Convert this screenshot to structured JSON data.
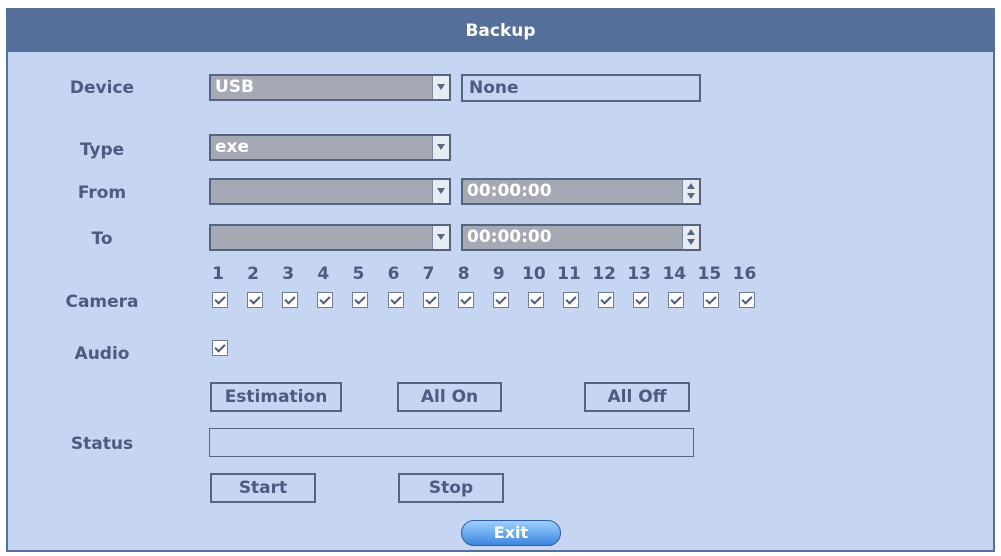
{
  "window": {
    "title": "Backup"
  },
  "device": {
    "label": "Device",
    "value": "USB",
    "name": "None"
  },
  "type": {
    "label": "Type",
    "value": "exe"
  },
  "from": {
    "label": "From",
    "date": "",
    "time": "00:00:00"
  },
  "to": {
    "label": "To",
    "date": "",
    "time": "00:00:00"
  },
  "camera": {
    "label": "Camera",
    "numbers": [
      "1",
      "2",
      "3",
      "4",
      "5",
      "6",
      "7",
      "8",
      "9",
      "10",
      "11",
      "12",
      "13",
      "14",
      "15",
      "16"
    ],
    "checked": [
      true,
      true,
      true,
      true,
      true,
      true,
      true,
      true,
      true,
      true,
      true,
      true,
      true,
      true,
      true,
      true
    ]
  },
  "audio": {
    "label": "Audio",
    "checked": true
  },
  "buttons": {
    "estimation": "Estimation",
    "all_on": "All On",
    "all_off": "All Off",
    "start": "Start",
    "stop": "Stop",
    "exit": "Exit"
  },
  "status": {
    "label": "Status",
    "value": ""
  },
  "colors": {
    "panel": "#c6d5f2",
    "titlebar": "#566e9a",
    "text": "#4d5b80",
    "combo": "#a5a9b4",
    "exit": "#3d86e0"
  }
}
